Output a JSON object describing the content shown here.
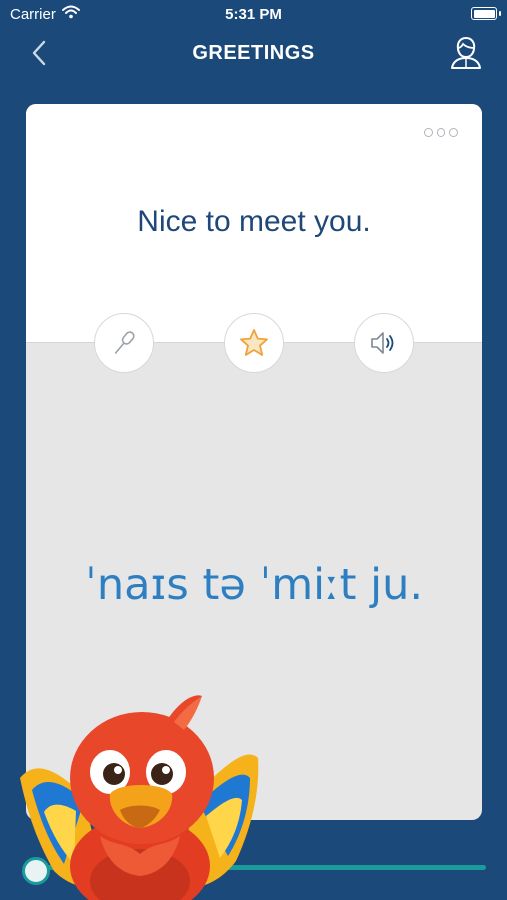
{
  "status_bar": {
    "carrier": "Carrier",
    "time": "5:31 PM"
  },
  "nav": {
    "title": "GREETINGS",
    "back_icon": "chevron-left-icon",
    "profile_icon": "person-icon"
  },
  "card": {
    "phrase": "Nice to meet you.",
    "ipa": "ˈnaɪs tə ˈmiːt ju.",
    "menu_icon": "more-dots-icon",
    "actions": [
      "microphone-icon",
      "star-icon",
      "speaker-icon"
    ]
  },
  "progress": {
    "value": 1.0
  },
  "colors": {
    "background": "#1b4a7a",
    "phrase_text": "#1f4878",
    "ipa_text": "#2d7fc1",
    "star": "#f0a23a",
    "progress": "#1a9c9c"
  }
}
